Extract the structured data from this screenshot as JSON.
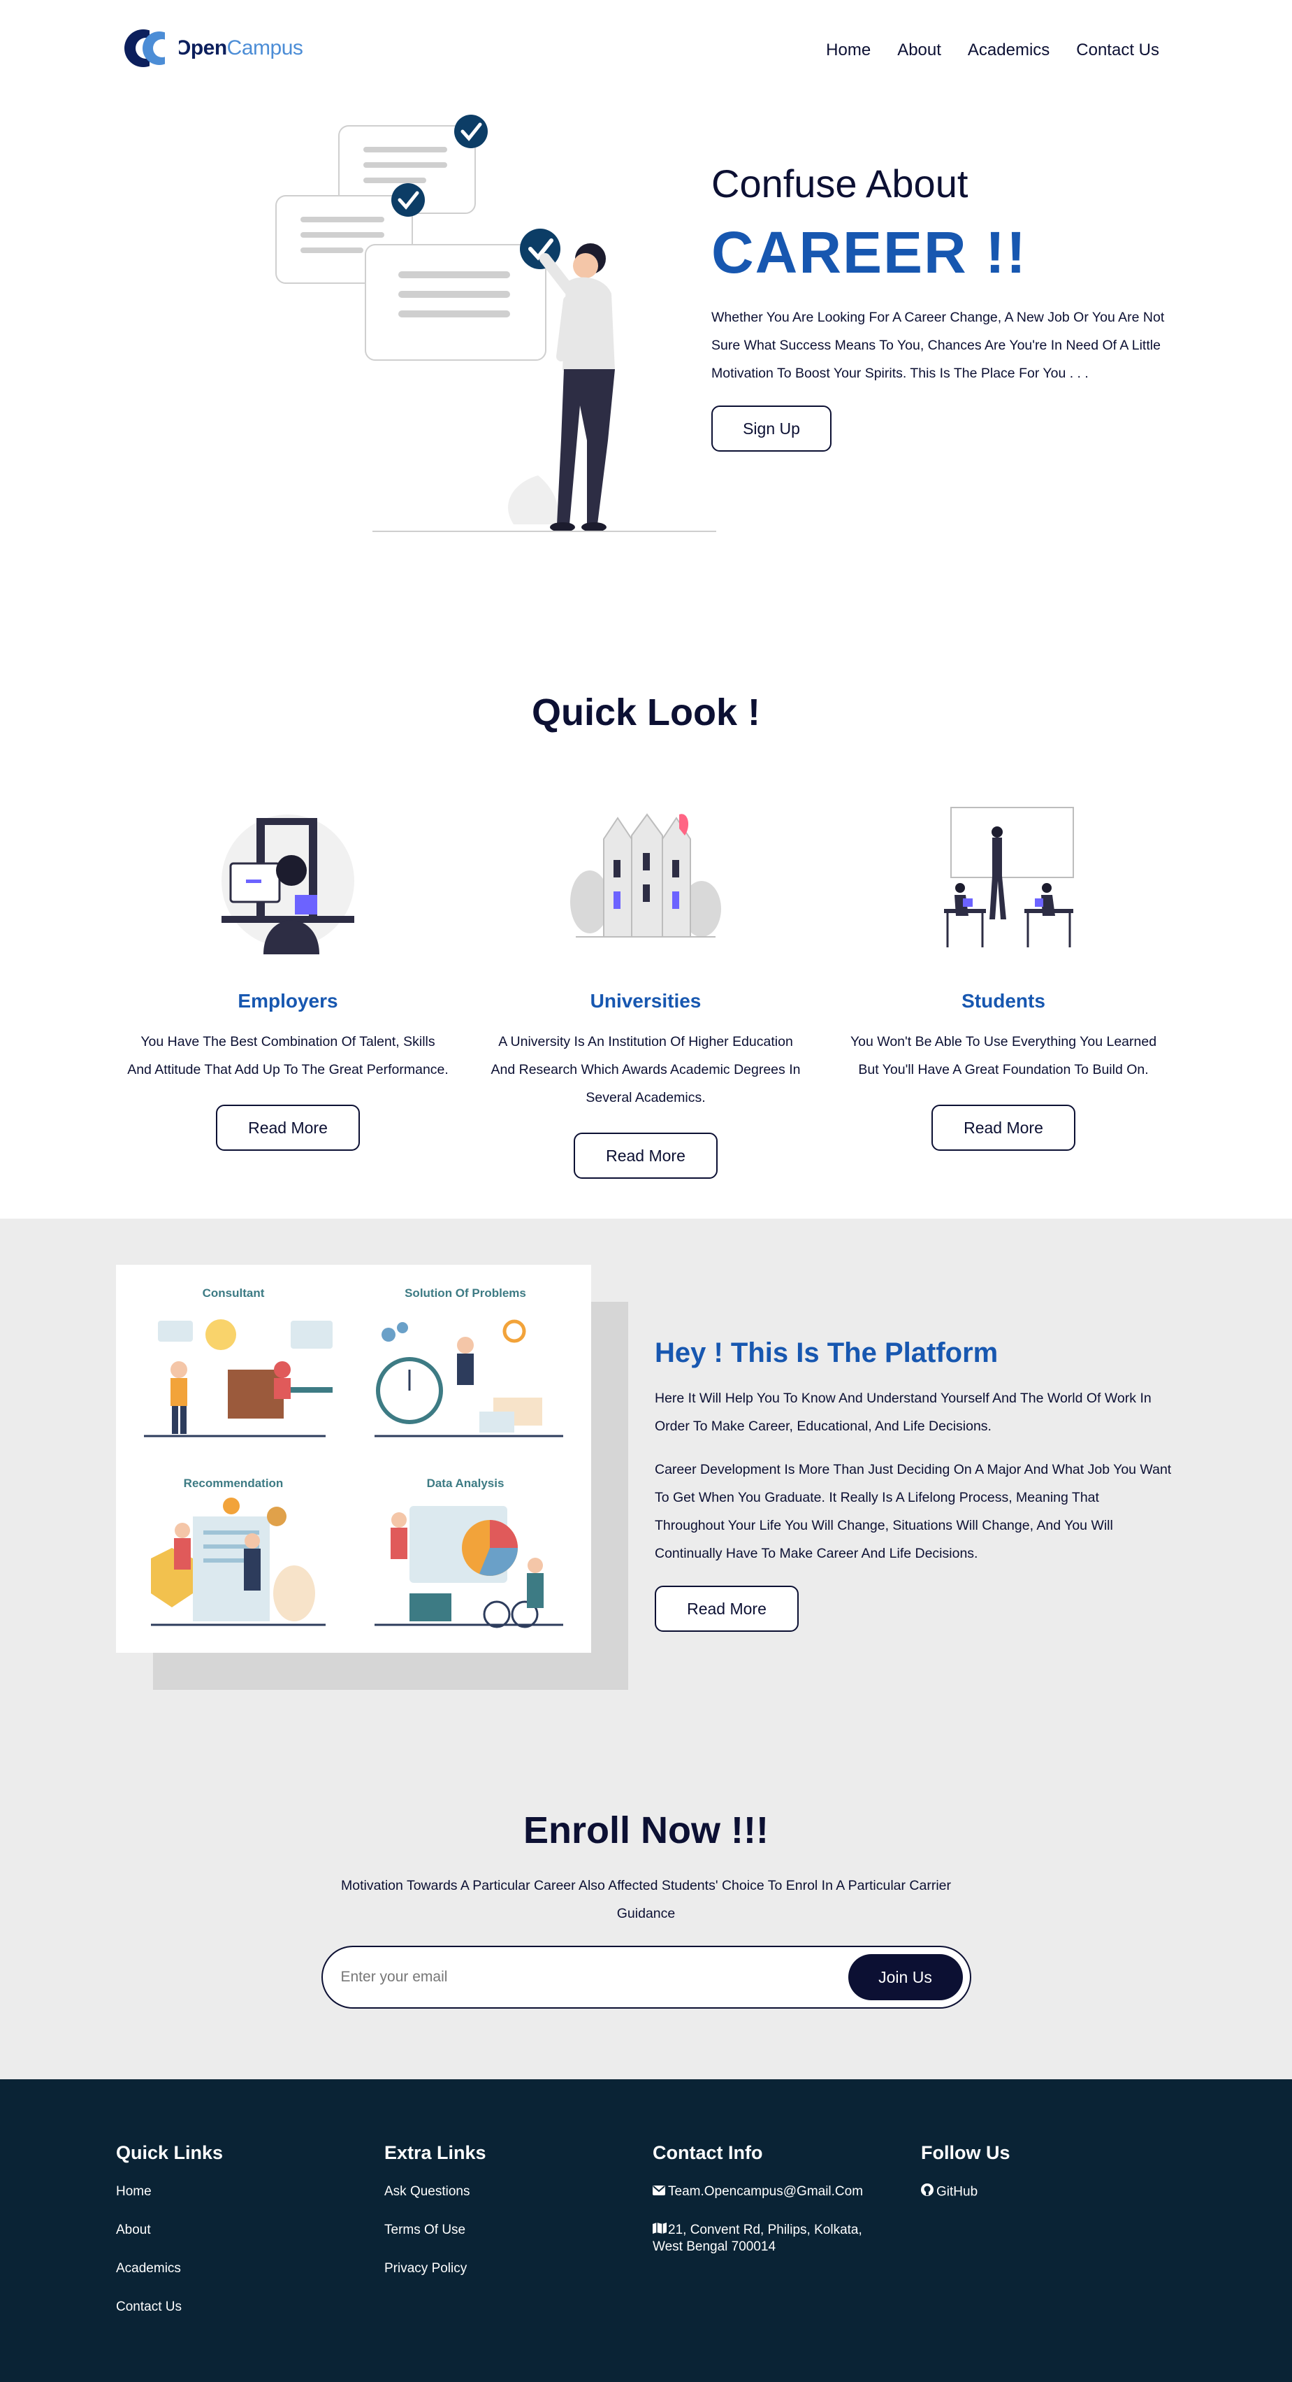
{
  "brand": {
    "name_part1": "Open",
    "name_part2": "Campus"
  },
  "nav": {
    "items": [
      "Home",
      "About",
      "Academics",
      "Contact Us"
    ]
  },
  "hero": {
    "subtitle": "Confuse About",
    "title": "CAREER !!",
    "description": "Whether You Are Looking For A Career Change, A New Job Or You Are Not Sure What Success Means To You, Chances Are You're In Need Of A Little Motivation To Boost Your Spirits. This Is The Place For You . . .",
    "button": "Sign Up"
  },
  "quick_look": {
    "title": "Quick Look !",
    "cards": [
      {
        "title": "Employers",
        "description": "You Have The Best Combination Of Talent, Skills And Attitude That Add Up To The Great Performance.",
        "button": "Read More"
      },
      {
        "title": "Universities",
        "description": "A University Is An Institution Of Higher Education And Research Which Awards Academic Degrees In Several Academics.",
        "button": "Read More"
      },
      {
        "title": "Students",
        "description": "You Won't Be Able To Use Everything You Learned But You'll Have A Great Foundation To Build On.",
        "button": "Read More"
      }
    ]
  },
  "platform": {
    "image_labels": [
      "Consultant",
      "Solution Of Problems",
      "Recommendation",
      "Data Analysis"
    ],
    "title": "Hey ! This Is The Platform",
    "paragraph1": "Here It Will Help You To Know And Understand Yourself And The World Of Work In Order To Make Career, Educational, And Life Decisions.",
    "paragraph2": "Career Development Is More Than Just Deciding On A Major And What Job You Want To Get When You Graduate. It Really Is A Lifelong Process, Meaning That Throughout Your Life You Will Change, Situations Will Change, And You Will Continually Have To Make Career And Life Decisions.",
    "button": "Read More"
  },
  "enroll": {
    "title": "Enroll Now !!!",
    "description": "Motivation Towards A Particular Career Also Affected Students' Choice To Enrol In A Particular Carrier Guidance",
    "placeholder": "Enter your email",
    "button": "Join Us"
  },
  "footer": {
    "quick_links": {
      "title": "Quick Links",
      "items": [
        "Home",
        "About",
        "Academics",
        "Contact Us"
      ]
    },
    "extra_links": {
      "title": "Extra Links",
      "items": [
        "Ask Questions",
        "Terms Of Use",
        "Privacy Policy"
      ]
    },
    "contact": {
      "title": "Contact Info",
      "email": "Team.Opencampus@Gmail.Com",
      "address": "21, Convent Rd, Philips, Kolkata, West Bengal 700014"
    },
    "follow": {
      "title": "Follow Us",
      "github": "GitHub"
    }
  },
  "colors": {
    "navy": "#0c1033",
    "blue": "#1757b0",
    "light_blue": "#4c8dd6",
    "footer_bg": "#0a2335",
    "section_bg": "#ececec"
  },
  "icons": [
    "logo-icon",
    "check-icon",
    "envelope-icon",
    "map-icon",
    "github-icon"
  ]
}
